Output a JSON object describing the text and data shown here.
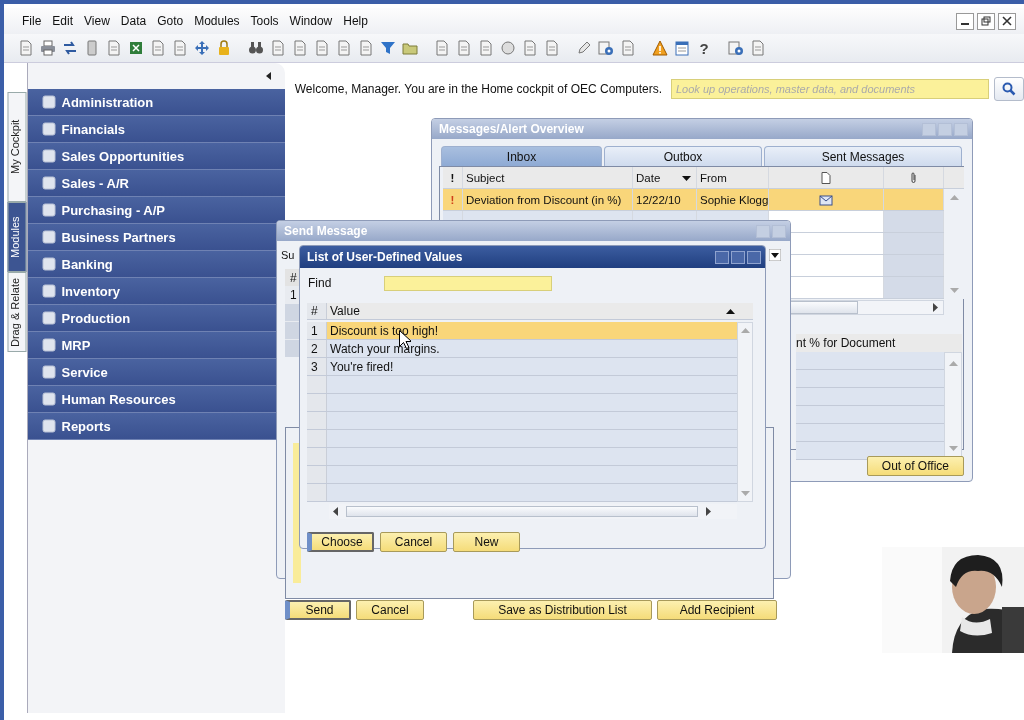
{
  "menu": [
    "File",
    "Edit",
    "View",
    "Data",
    "Goto",
    "Modules",
    "Tools",
    "Window",
    "Help"
  ],
  "toolbar": {
    "help_glyph": "?"
  },
  "side_tabs": [
    {
      "label": "My Cockpit",
      "selected": false
    },
    {
      "label": "Modules",
      "selected": true
    },
    {
      "label": "Drag & Relate",
      "selected": false
    }
  ],
  "modules": [
    "Administration",
    "Financials",
    "Sales Opportunities",
    "Sales - A/R",
    "Purchasing - A/P",
    "Business Partners",
    "Banking",
    "Inventory",
    "Production",
    "MRP",
    "Service",
    "Human Resources",
    "Reports"
  ],
  "welcome": "Welcome, Manager. You are in the Home cockpit of OEC Computers.",
  "search": {
    "placeholder": "Look up operations, master data, and documents"
  },
  "messages_window": {
    "title": "Messages/Alert Overview",
    "tabs": [
      {
        "label": "Inbox",
        "selected": true
      },
      {
        "label": "Outbox",
        "selected": false
      },
      {
        "label": "Sent Messages",
        "selected": false
      }
    ],
    "columns": [
      "!",
      "Subject",
      "Date",
      "From"
    ],
    "rows": [
      {
        "priority": "!",
        "subject": "Deviation from Discount (in %)",
        "date": "12/22/10",
        "from": "Sophie Klogg",
        "selected": true
      }
    ],
    "detail_column": "nt % for Document",
    "button": "Out of Office"
  },
  "send_window": {
    "title": "Send Message",
    "subject_label": "Su",
    "grid_header": "#",
    "grid_row": "1",
    "buttons": [
      {
        "label": "Send",
        "default": true
      },
      {
        "label": "Cancel",
        "default": false
      },
      {
        "label": "Save as Distribution List",
        "default": false
      },
      {
        "label": "Add Recipient",
        "default": false
      }
    ]
  },
  "list_window": {
    "title": "List of User-Defined Values",
    "find_label": "Find",
    "columns": [
      "#",
      "Value"
    ],
    "rows": [
      {
        "number": "1",
        "value": "Discount is too high!",
        "selected": true
      },
      {
        "number": "2",
        "value": "Watch your margins.",
        "selected": false
      },
      {
        "number": "3",
        "value": "You're fired!",
        "selected": false
      }
    ],
    "buttons": [
      {
        "label": "Choose",
        "default": true
      },
      {
        "label": "Cancel",
        "default": false
      },
      {
        "label": "New",
        "default": false
      }
    ]
  }
}
